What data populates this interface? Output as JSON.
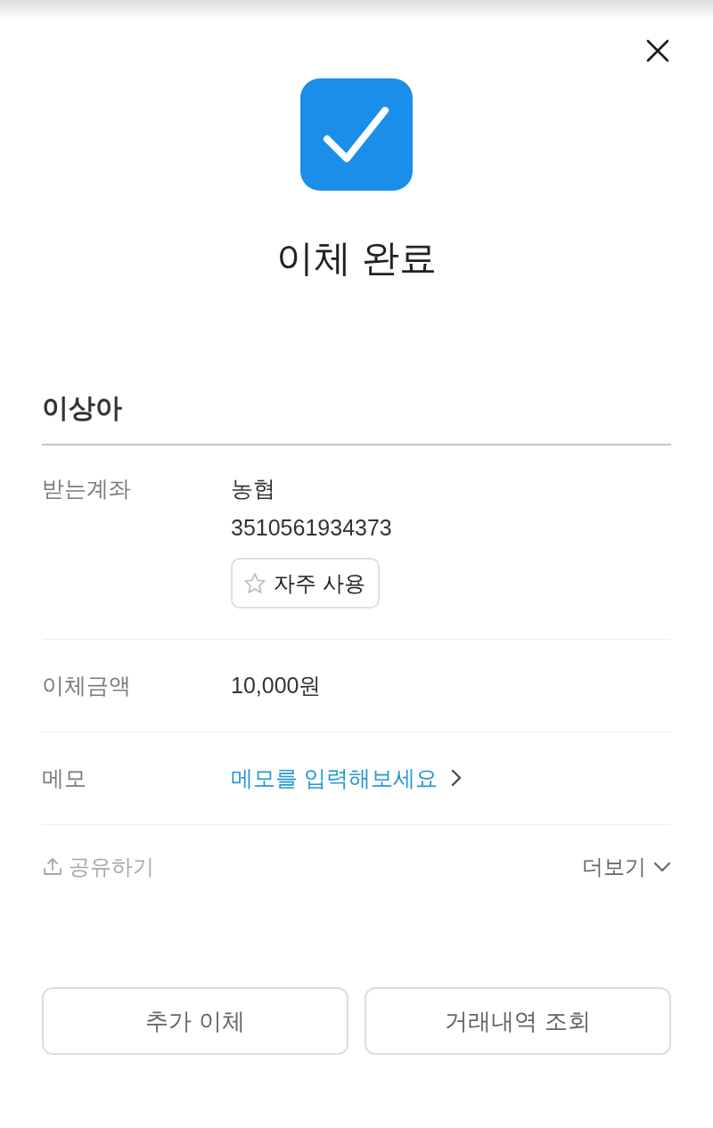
{
  "title": "이체 완료",
  "recipient": {
    "name": "이상아"
  },
  "details": [
    {
      "kind": "account",
      "label": "받는계좌",
      "bank": "농협",
      "account_number": "3510561934373",
      "favorite": {
        "label": "자주 사용",
        "starred": false
      }
    },
    {
      "kind": "amount",
      "label": "이체금액",
      "value": "10,000원"
    },
    {
      "kind": "memo",
      "label": "메모",
      "prompt": "메모를 입력해보세요"
    }
  ],
  "share": {
    "label": "공유하기"
  },
  "more": {
    "label": "더보기",
    "expanded": false
  },
  "buttons": [
    "추가 이체",
    "거래내역 조회"
  ]
}
